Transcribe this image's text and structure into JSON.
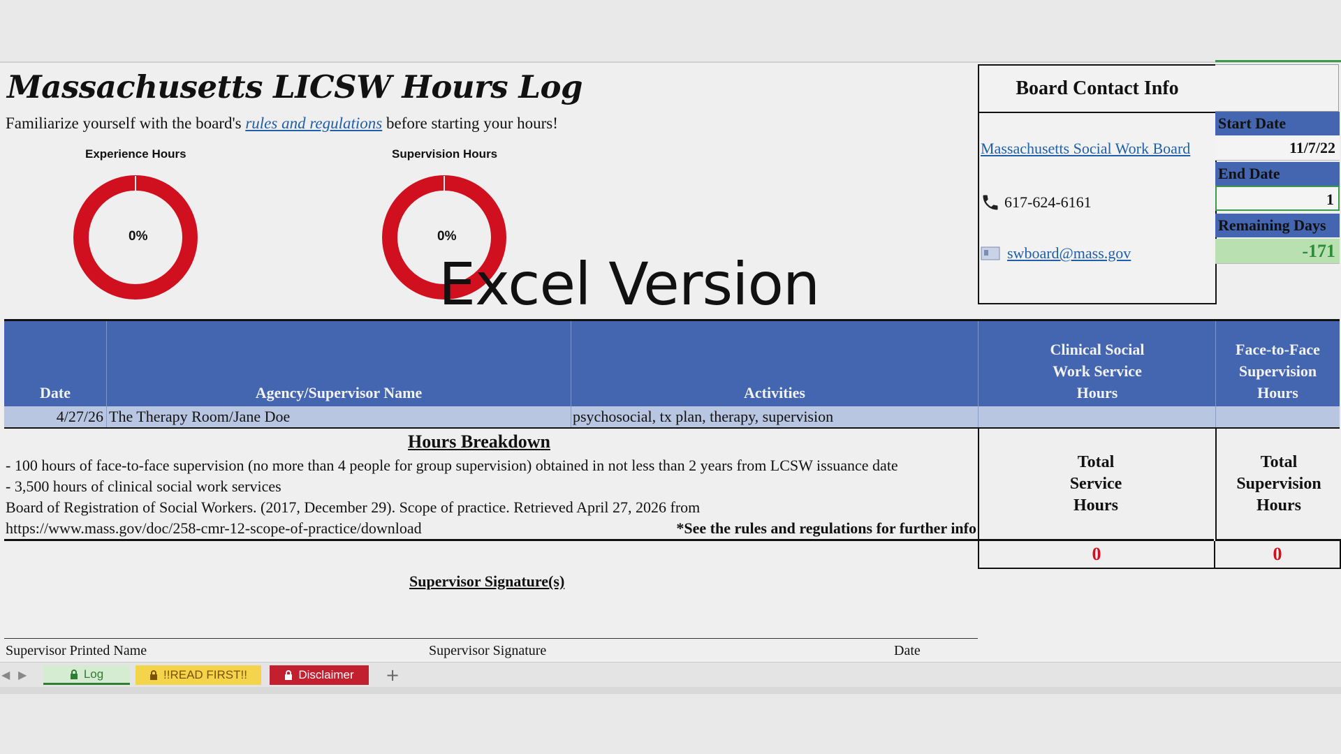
{
  "title": "Massachusetts LICSW Hours Log",
  "intro": {
    "before": "Familiarize yourself with the board's ",
    "link": "rules and regulations",
    "after": " before starting your hours!"
  },
  "charts": {
    "experience": {
      "label": "Experience Hours",
      "percent": "0%"
    },
    "supervision": {
      "label": "Supervision Hours",
      "percent": "0%"
    }
  },
  "watermark": "Excel Version",
  "contact": {
    "title": "Board Contact Info",
    "board_link": "Massachusetts Social Work Board",
    "phone": "617-624-6161",
    "email": "swboard@mass.gov"
  },
  "dates": {
    "start_label": "Start Date",
    "start_value": "11/7/22",
    "end_label": "End Date",
    "end_value": "1",
    "remaining_label": "Remaining Days",
    "remaining_value": "-171"
  },
  "table": {
    "headers": {
      "date": "Date",
      "agency": "Agency/Supervisor Name",
      "activities": "Activities",
      "clinical": "Clinical Social Work Service Hours",
      "f2f": "Face-to-Face Supervision Hours"
    },
    "row": {
      "date": "4/27/26",
      "agency": "The Therapy Room/Jane Doe",
      "activities": "psychosocial, tx plan, therapy, supervision"
    }
  },
  "breakdown": {
    "title": "Hours Breakdown",
    "line1": "- 100 hours of face-to-face supervision (no more than 4 people for group supervision) obtained in not less than 2 years from LCSW issuance date",
    "line2": "- 3,500 hours of clinical social work services",
    "line3": "Board of Registration of Social Workers. (2017, December 29). Scope of practice. Retrieved April 27, 2026 from",
    "line4": "https://www.mass.gov/doc/258-cmr-12-scope-of-practice/download",
    "note": "*See the rules and regulations for further info"
  },
  "totals": {
    "service_label": "Total Service Hours",
    "service_value": "0",
    "supervision_label": "Total Supervision Hours",
    "supervision_value": "0"
  },
  "signature": {
    "title": "Supervisor Signature(s)",
    "printed_name": "Supervisor Printed Name",
    "signature": "Supervisor Signature",
    "date": "Date"
  },
  "tabs": {
    "log": "Log",
    "read_first": "!!READ FIRST!!",
    "disclaimer": "Disclaimer",
    "add": "+"
  },
  "colors": {
    "header_blue": "#4466b0",
    "donut_red": "#d0101e",
    "remaining_green": "#2e8b3a"
  }
}
